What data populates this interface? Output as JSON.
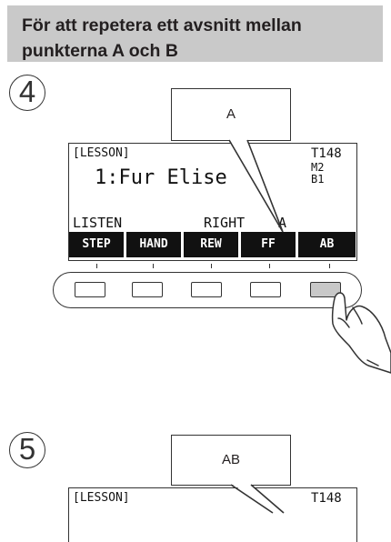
{
  "header": {
    "line1": "För att repetera ett avsnitt mellan",
    "line2": "punkterna A och B"
  },
  "step4": {
    "number": "4",
    "callout": "A",
    "lcd": {
      "mode": "[LESSON]",
      "song": "1:Fur Elise",
      "tempo": "T148",
      "measure": "M2",
      "beat": "B1",
      "status_left": "LISTEN",
      "status_right": "RIGHT",
      "status_point": "A",
      "softkeys": [
        "STEP",
        "HAND",
        "REW",
        "FF",
        "AB"
      ]
    },
    "pressed_button": "AB"
  },
  "step5": {
    "number": "5",
    "callout": "AB",
    "lcd": {
      "mode": "[LESSON]",
      "tempo": "T148"
    }
  },
  "colors": {
    "header_bg": "#c9c9c9",
    "softkey_bg": "#111111",
    "pressed_button": "#c8c8c8"
  },
  "icons": {
    "hand": "hand-pointer-icon"
  }
}
